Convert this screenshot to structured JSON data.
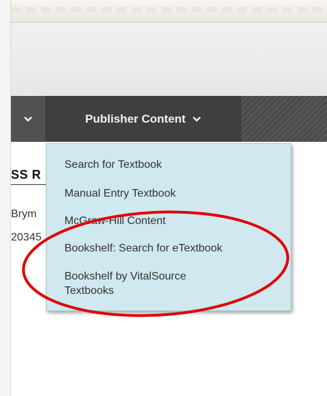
{
  "navbar": {
    "active_tab_label": "Publisher Content"
  },
  "page": {
    "heading_partial": "SS R",
    "line1_partial": "Brym",
    "line2_partial": "20345"
  },
  "dropdown": {
    "items": [
      {
        "label": "Search for Textbook"
      },
      {
        "label": "Manual Entry Textbook"
      },
      {
        "label": "McGraw-Hill Content"
      },
      {
        "label": "Bookshelf: Search for eTextbook"
      },
      {
        "label": "Bookshelf by VitalSource Textbooks"
      }
    ]
  },
  "colors": {
    "navbar_bg": "#3f3f3f",
    "dropdown_bg": "#d0e8ef",
    "annotation_ellipse": "#e00000"
  }
}
